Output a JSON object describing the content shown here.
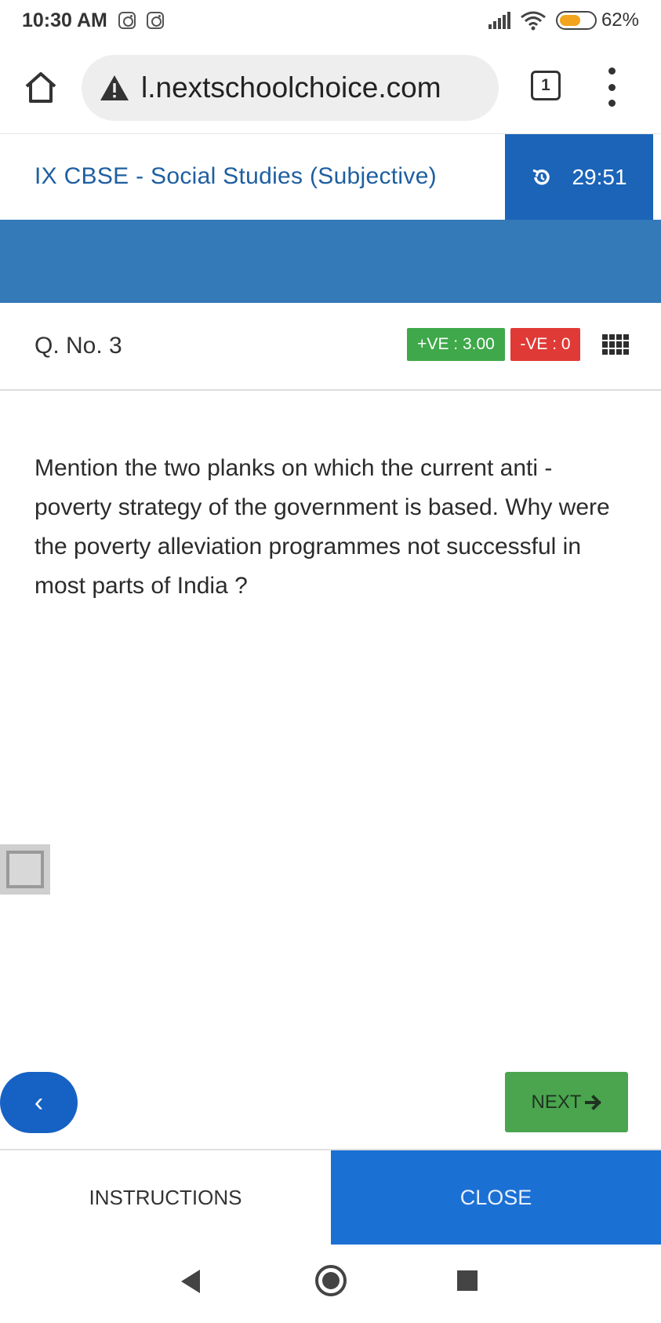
{
  "status_bar": {
    "time": "10:30 AM",
    "battery_percent": "62%",
    "battery_level": 0.62,
    "notification_icons": [
      "instagram-icon",
      "instagram-icon"
    ]
  },
  "browser": {
    "url": "l.nextschoolchoice.com",
    "tab_count": "1",
    "icons": [
      "home-icon",
      "warning-icon",
      "more-vert-icon"
    ]
  },
  "header": {
    "title": "IX CBSE - Social Studies (Subjective)",
    "timer": "29:51",
    "timer_icon": "history-icon"
  },
  "question": {
    "number_label": "Q. No. 3",
    "positive_marks": "+VE : 3.00",
    "negative_marks": "-VE : 0",
    "text": "Mention the two planks on which the current anti - poverty strategy of the government is based. Why were the poverty alleviation programmes not successful in most parts of  India ?"
  },
  "navigation": {
    "prev_label": "‹",
    "next_label": "NEXT"
  },
  "footer": {
    "instructions_label": "INSTRUCTIONS",
    "close_label": "CLOSE"
  },
  "colors": {
    "timer_bg": "#1b64b8",
    "band": "#3479b8",
    "positive": "#3fa84a",
    "negative": "#e03a37",
    "close_bg": "#1b70d4",
    "prev_bg": "#1662c4",
    "next_bg": "#4aa54e"
  }
}
